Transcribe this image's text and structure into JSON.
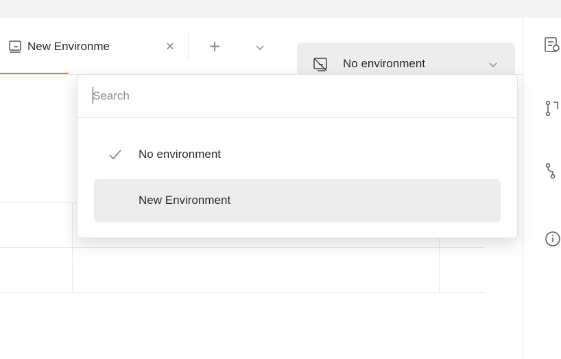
{
  "tabs": {
    "active_tab_label": "New Environme",
    "close_glyph": "×",
    "add_glyph": "+"
  },
  "environment_selector": {
    "selected_label": "No environment"
  },
  "dropdown": {
    "search": {
      "placeholder": "Search",
      "value": ""
    },
    "options": [
      {
        "label": "No environment",
        "selected": true
      },
      {
        "label": "New Environment",
        "selected": false,
        "hovered": true
      }
    ]
  },
  "colors": {
    "accent": "#ff6c37",
    "selector_bg": "#ededed",
    "hover_bg": "#ededed"
  },
  "icons": {
    "tab_icon": "environment-icon",
    "tab_menu": "chevron-down-icon",
    "env_icon": "no-environment-icon",
    "env_chevron": "chevron-down-icon",
    "right_top": "environment-quick-look-icon",
    "side": [
      "pull-request-icon",
      "fork-icon",
      "info-icon"
    ],
    "check": "check-icon"
  }
}
